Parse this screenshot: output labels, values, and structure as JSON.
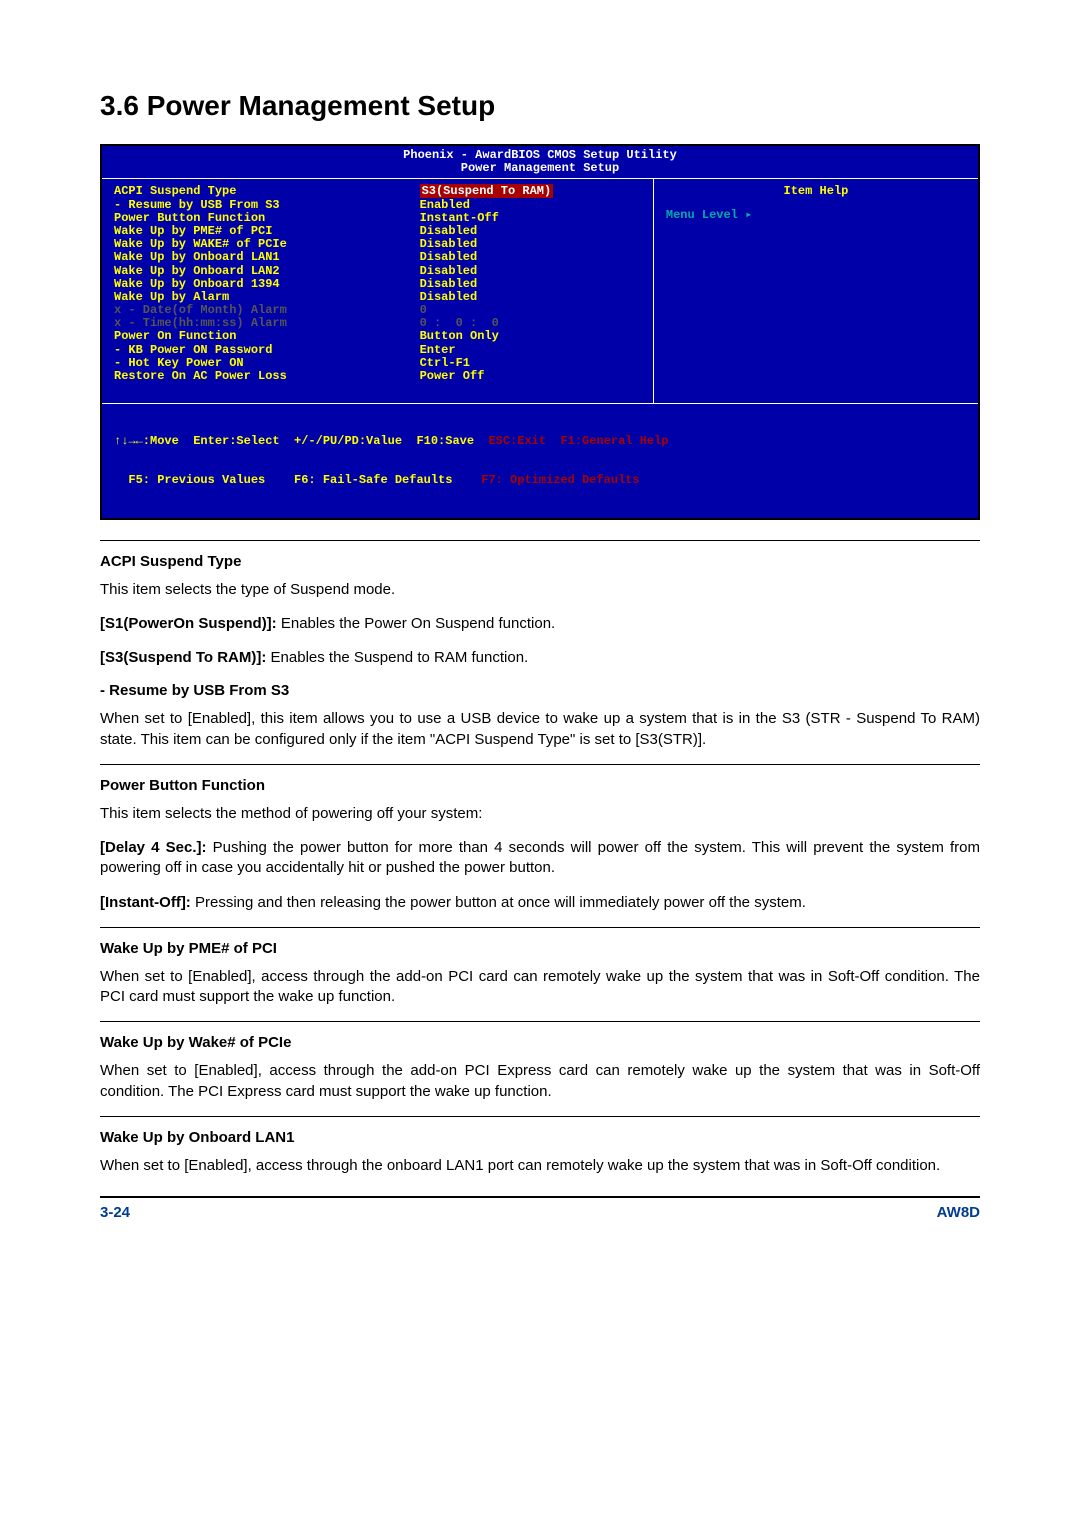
{
  "heading": "3.6 Power Management Setup",
  "bios": {
    "title_line1": "Phoenix - AwardBIOS CMOS Setup Utility",
    "title_line2": "Power Management Setup",
    "rows": [
      {
        "label": "ACPI Suspend Type",
        "value": "S3(Suspend To RAM)",
        "highlighted": true
      },
      {
        "label": "- Resume by USB From S3",
        "value": "Enabled"
      },
      {
        "label": "Power Button Function",
        "value": "Instant-Off"
      },
      {
        "label": "Wake Up by PME# of PCI",
        "value": "Disabled"
      },
      {
        "label": "Wake Up by WAKE# of PCIe",
        "value": "Disabled"
      },
      {
        "label": "Wake Up by Onboard LAN1",
        "value": "Disabled"
      },
      {
        "label": "Wake Up by Onboard LAN2",
        "value": "Disabled"
      },
      {
        "label": "Wake Up by Onboard 1394",
        "value": "Disabled"
      },
      {
        "label": "Wake Up by Alarm",
        "value": "Disabled"
      },
      {
        "label": "x - Date(of Month) Alarm",
        "value": "0",
        "disabled": true
      },
      {
        "label": "x - Time(hh:mm:ss) Alarm",
        "value": "0 :  0 :  0",
        "disabled": true
      },
      {
        "label": "Power On Function",
        "value": "Button Only"
      },
      {
        "label": "- KB Power ON Password",
        "value": "Enter"
      },
      {
        "label": "- Hot Key Power ON",
        "value": "Ctrl-F1"
      },
      {
        "label": "Restore On AC Power Loss",
        "value": "Power Off"
      }
    ],
    "help_title": "Item Help",
    "menu_level": "Menu Level   ▸",
    "footer_line1_left": "↑↓→←:Move  Enter:Select  +/-/PU/PD:Value  F10:Save  ",
    "footer_line1_right": "ESC:Exit  F1:General Help",
    "footer_line2_left": "  F5: Previous Values    F6: Fail-Safe Defaults    ",
    "footer_line2_right": "F7: Optimized Defaults"
  },
  "body": {
    "acpi_title": "ACPI Suspend Type",
    "acpi_p1": "This item selects the type of Suspend mode.",
    "acpi_s1_opt": "[S1(PowerOn Suspend)]:",
    "acpi_s1_txt": " Enables the Power On Suspend function.",
    "acpi_s3_opt": "[S3(Suspend To RAM)]:",
    "acpi_s3_txt": " Enables the Suspend to RAM function.",
    "resume_title": "-   Resume by USB From S3",
    "resume_p": "When set to [Enabled], this item allows you to use a USB device to wake up a system that is in the S3 (STR - Suspend To RAM) state. This item can be configured only if the item \"ACPI Suspend Type\" is set to [S3(STR)].",
    "pbf_title": "Power Button Function",
    "pbf_p1": "This item selects the method of powering off your system:",
    "pbf_delay_opt": "[Delay 4 Sec.]:",
    "pbf_delay_txt": " Pushing the power button for more than 4 seconds will power off the system. This will prevent the system from powering off in case you accidentally hit or pushed the power button.",
    "pbf_instant_opt": "[Instant-Off]:",
    "pbf_instant_txt": " Pressing and then releasing the power button at once will immediately power off the system.",
    "pme_title": "Wake Up by PME# of PCI",
    "pme_p": "When set to [Enabled], access through the add-on PCI card can remotely wake up the system that was in Soft-Off condition. The PCI card must support the wake up function.",
    "wake_title": "Wake Up by Wake# of PCIe",
    "wake_p": "When set to [Enabled], access through the add-on PCI Express card can remotely wake up the system that was in Soft-Off condition. The PCI Express card must support the wake up function.",
    "lan1_title": "Wake Up by Onboard LAN1",
    "lan1_p": "When set to [Enabled], access through the onboard LAN1 port can remotely wake up the system that was in Soft-Off condition."
  },
  "footer": {
    "left": "3-24",
    "right": "AW8D"
  }
}
